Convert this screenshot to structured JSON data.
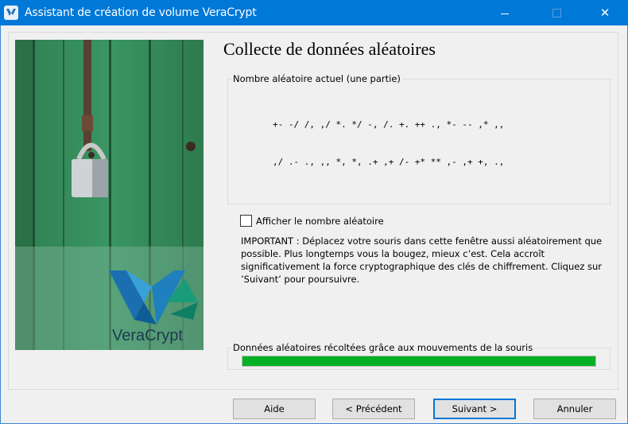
{
  "window": {
    "title": "Assistant de création de volume VeraCrypt",
    "close_glyph": "✕"
  },
  "page": {
    "title": "Collecte de données aléatoires"
  },
  "random_pool": {
    "label": "Nombre aléatoire actuel (une partie)",
    "lines": [
      "+- -/ /, ,/ *. */ -, /. +. ++ ., *- -- ,* ,,",
      ",/ .- ., ,, *, *, .+ ,+ /- +* ** ,- ,+ +, .,",
      "+/ */ *, *. +* *, -/ ++ *. -* .. ./ ,+ ,, /*",
      ".* .. .- ,- -, .- ./ -* -. ,. ,* /, +* ,/ .*",
      "*+ -. *- -+ -, /, ,+ +, /- ++ -* ,, *, /- ,/",
      "-* +. +* ,. ,/ -* .+ -. -* .+ .* *, *- *+ /,",
      "++ +* */ ,+ .+ ,- ++ *+ *- *, */ ,* ,- ,- +-",
      "., ,/ .. +. +. ,/ -/ +. ,. ., ,. *. -. -* -+"
    ]
  },
  "show_random": {
    "label": "Afficher le nombre aléatoire",
    "checked": false
  },
  "important_text": "IMPORTANT : Déplacez votre souris dans cette fenêtre aussi aléatoirement que possible. Plus longtemps vous la bougez, mieux c’est. Cela accroît significativement la force cryptographique des clés de chiffrement. Cliquez sur ’Suivant’ pour poursuivre.",
  "mouse_collection": {
    "label": "Données aléatoires récoltées grâce aux mouvements de la souris",
    "progress_percent": 100,
    "bar_color": "#06b025"
  },
  "branding": {
    "logo_text": "VeraCrypt"
  },
  "buttons": {
    "help": "Aide",
    "previous": "< Précédent",
    "next": "Suivant >",
    "cancel": "Annuler"
  },
  "colors": {
    "titlebar": "#0078d7",
    "default_button_border": "#0078d7"
  },
  "icons": {
    "app": "veracrypt-logo-icon",
    "minimize": "minimize-icon",
    "maximize": "maximize-icon",
    "close": "close-icon"
  }
}
